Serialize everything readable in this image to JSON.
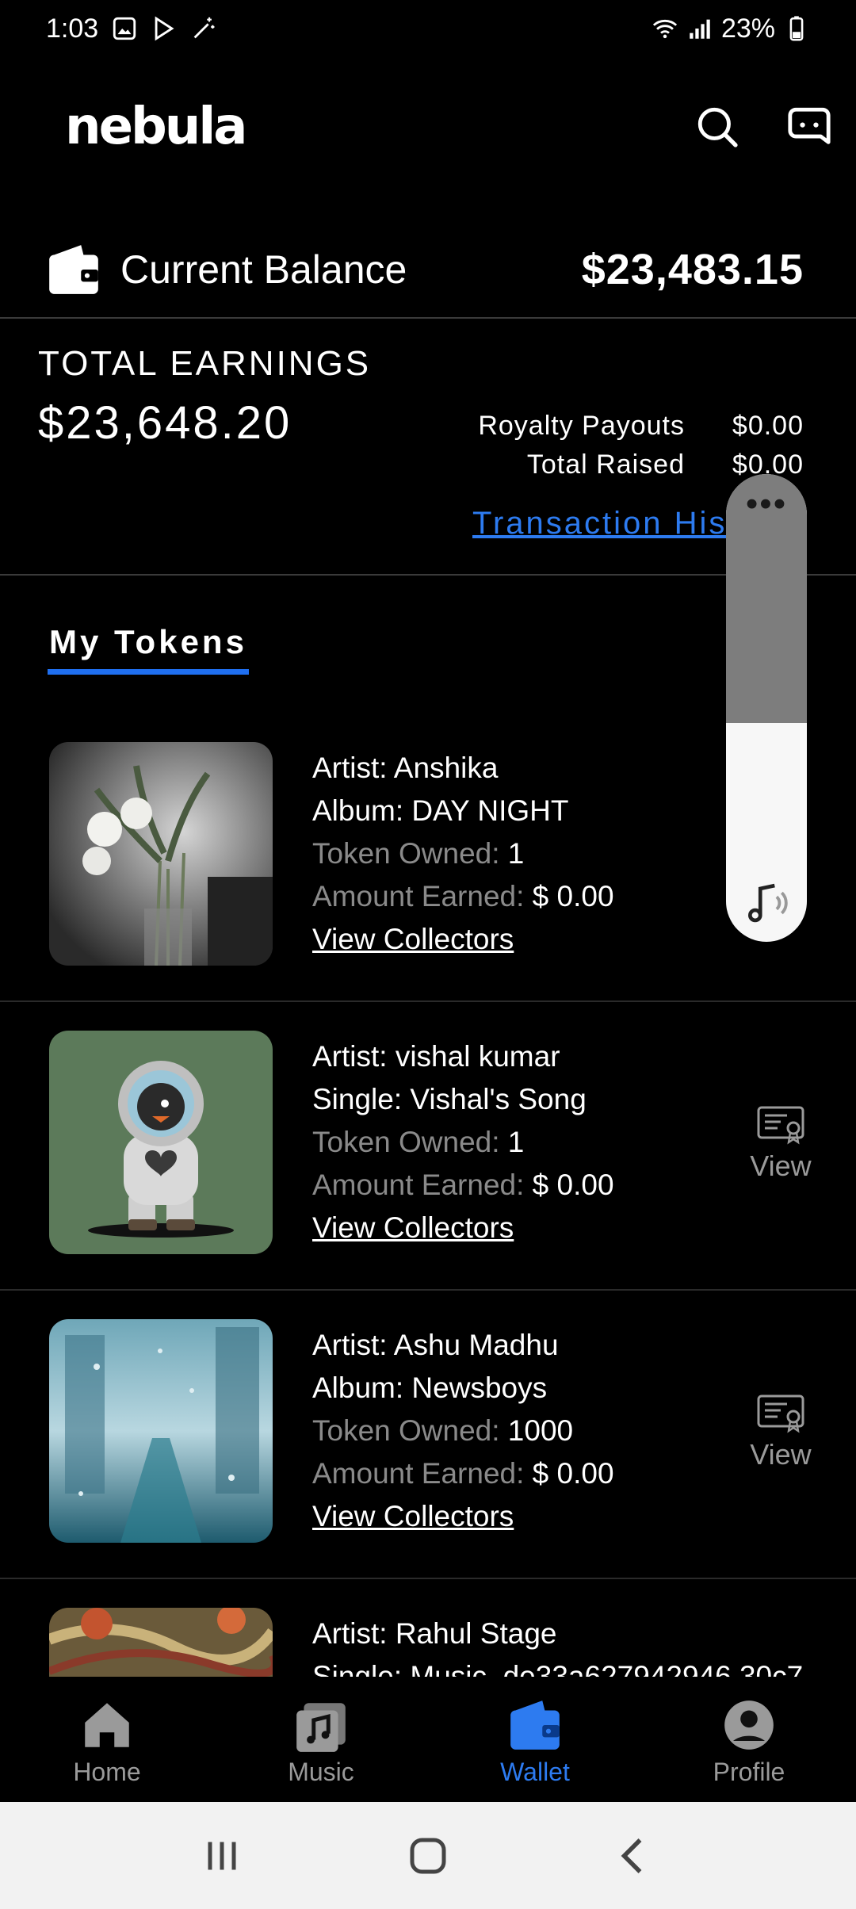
{
  "status": {
    "time": "1:03",
    "battery": "23%"
  },
  "app": {
    "logo": "nebula"
  },
  "balance": {
    "label": "Current Balance",
    "value": "$23,483.15"
  },
  "earnings": {
    "title": "TOTAL EARNINGS",
    "value": "$23,648.20",
    "royalty_label": "Royalty Payouts",
    "royalty_value": "$0.00",
    "raised_label": "Total Raised",
    "raised_value": "$0.00",
    "transaction_link": "Transaction His"
  },
  "tabs": {
    "my_tokens": "My Tokens"
  },
  "tokens": [
    {
      "artist": "Artist: Anshika",
      "release": "Album: DAY NIGHT",
      "owned_label": "Token Owned:",
      "owned": " 1",
      "earned_label": "Amount Earned:",
      "earned": " $ 0.00",
      "collectors": "View Collectors",
      "view": ""
    },
    {
      "artist": "Artist: vishal kumar",
      "release": "Single: Vishal's Song",
      "owned_label": "Token Owned:",
      "owned": " 1",
      "earned_label": "Amount Earned:",
      "earned": " $ 0.00",
      "collectors": "View Collectors",
      "view": "View"
    },
    {
      "artist": "Artist: Ashu Madhu",
      "release": "Album: Newsboys",
      "owned_label": "Token Owned:",
      "owned": " 1000",
      "earned_label": "Amount Earned:",
      "earned": " $ 0.00",
      "collectors": "View Collectors",
      "view": "View"
    },
    {
      "artist": "Artist: Rahul Stage",
      "release": "Single: Music_de33a627942946 30c7",
      "owned_label": "",
      "owned": "",
      "earned_label": "",
      "earned": "",
      "collectors": "",
      "view": ""
    }
  ],
  "nav": {
    "home": "Home",
    "music": "Music",
    "wallet": "Wallet",
    "profile": "Profile"
  },
  "colors": {
    "accent": "#2d7bf0",
    "background": "#000000",
    "muted": "#8a8a8a"
  }
}
